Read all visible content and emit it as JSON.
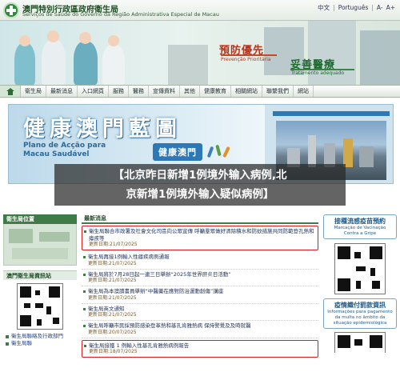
{
  "header": {
    "org_zh": "澳門特別行政區政府衛生局",
    "org_pt": "Serviços de Saúde do Governo da Região Administrativa Especial de Macau",
    "lang": [
      "中文",
      "Português",
      "A-",
      "A+"
    ]
  },
  "hero": {
    "prio_zh": "預防優先",
    "prio_pt": "Prevenção Prioritária",
    "treat_zh": "妥善醫療",
    "treat_pt": "Tratamento adequado"
  },
  "nav": {
    "items": [
      "衛生局",
      "最新消息",
      "入口網頁",
      "服務",
      "醫務",
      "宣傳資料",
      "其他",
      "健康教育",
      "相關網站",
      "聯繫我們",
      "網站"
    ]
  },
  "banner": {
    "title": "健康澳門藍圖",
    "subtitle_pt": "Plano de Acção para\nMacau Saudável",
    "logo_text": "健康澳門"
  },
  "headline": {
    "line1": "【北京昨日新增1例境外输入病例,北",
    "line2": "京新增1例境外输入疑似病例】"
  },
  "left": {
    "location_title": "衛生局位置",
    "info_title": "澳門衛生局資訊站",
    "links": [
      "衛生局聯絡及行政部門",
      "衛生局聯"
    ]
  },
  "news": {
    "title": "最新消息",
    "items": [
      {
        "title": "衛生局聯合市政署及社會文化司區向公眾宣傳 呼籲羣眾做好清除積水和防蚊措施共同防範登孔熱和瘧疾等",
        "date": "更新日期:21/07/2025",
        "highlight": true
      },
      {
        "title": "衛生局再接1例輸入性瘧疾病例通報",
        "date": "更新日期:21/07/2025",
        "highlight": false
      },
      {
        "title": "衛生局將於7月28日起一連三日舉辦“2025年世界肝炎日活動”",
        "date": "更新日期:21/07/2025",
        "highlight": false
      },
      {
        "title": "衛生局為本澳讀書員舉辦“中醫藥在應對防治運動創傷”講座",
        "date": "更新日期:21/07/2025",
        "highlight": false
      },
      {
        "title": "衛生局英文通知",
        "date": "更新日期:21/07/2025",
        "highlight": false
      },
      {
        "title": "衛生局呼籲市民採預防感染登革熱和基孔肯雅熱病 保持警覺及及時就醫",
        "date": "更新日期:20/07/2025",
        "highlight": false
      },
      {
        "title": "衛生局接獲 1 例輸入性基孔肯雅熱病例報告",
        "date": "更新日期:18/07/2025",
        "highlight": true
      }
    ]
  },
  "right": {
    "vaccine_zh": "接種流感疫苗預約",
    "vaccine_pt": "Marcação de Vacinação\nContra a Gripe",
    "mask_zh": "疫情織付罰款資訊",
    "mask_pt": "Informações para pagamento da multa no âmbito da situação epidemiológica"
  },
  "colors": {
    "brand_green": "#3f7a47",
    "highlight_red": "#d21f1f",
    "link_blue": "#1f2f5a"
  }
}
